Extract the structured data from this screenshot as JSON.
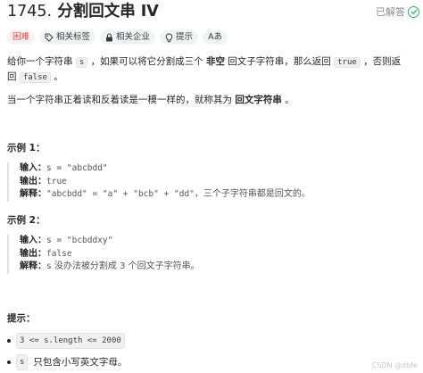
{
  "header": {
    "number": "1745.",
    "title": "分割回文串 IV",
    "status": "已解答"
  },
  "tags": {
    "difficulty": "困难",
    "related_tags": "相关标签",
    "related_companies": "相关企业",
    "hint": "提示",
    "font_toggle": "Aあ"
  },
  "description": {
    "p1_a": "给你一个字符串",
    "p1_code_s": "s",
    "p1_b": "，如果可以将它分割成三个",
    "p1_bold": "非空",
    "p1_c": "回文子字符串，那么返回",
    "p1_code_true": "true",
    "p1_d": "，否则返",
    "p1_e": "回",
    "p1_code_false": "false",
    "p1_f": "。",
    "p2_a": "当一个字符串正着读和反着读是一模一样的，就称其为",
    "p2_bold": "回文字符串",
    "p2_b": "。"
  },
  "example1": {
    "heading": "示例 1：",
    "input_label": "输入：",
    "input_value": "s = \"abcbdd\"",
    "output_label": "输出：",
    "output_value": "true",
    "explain_label": "解释：",
    "explain_code": "\"abcbdd\" = \"a\" + \"bcb\" + \"dd\"",
    "explain_text": "，三个子字符串都是回文的。"
  },
  "example2": {
    "heading": "示例 2：",
    "input_label": "输入：",
    "input_value": "s = \"bcbddxy\"",
    "output_label": "输出：",
    "output_value": "false",
    "explain_label": "解释：",
    "explain_code": "s",
    "explain_text": " 没办法被分割成 3 个回文子字符串。"
  },
  "constraints": {
    "heading": "提示：",
    "c1_code": "3 <= s.length <= 2000",
    "c2_code": "s",
    "c2_text": "只包含小写英文字母。"
  },
  "watermark": "CSDN @dbfe",
  "colors": {
    "hard": "#ef4743",
    "solved": "#2db55d"
  }
}
